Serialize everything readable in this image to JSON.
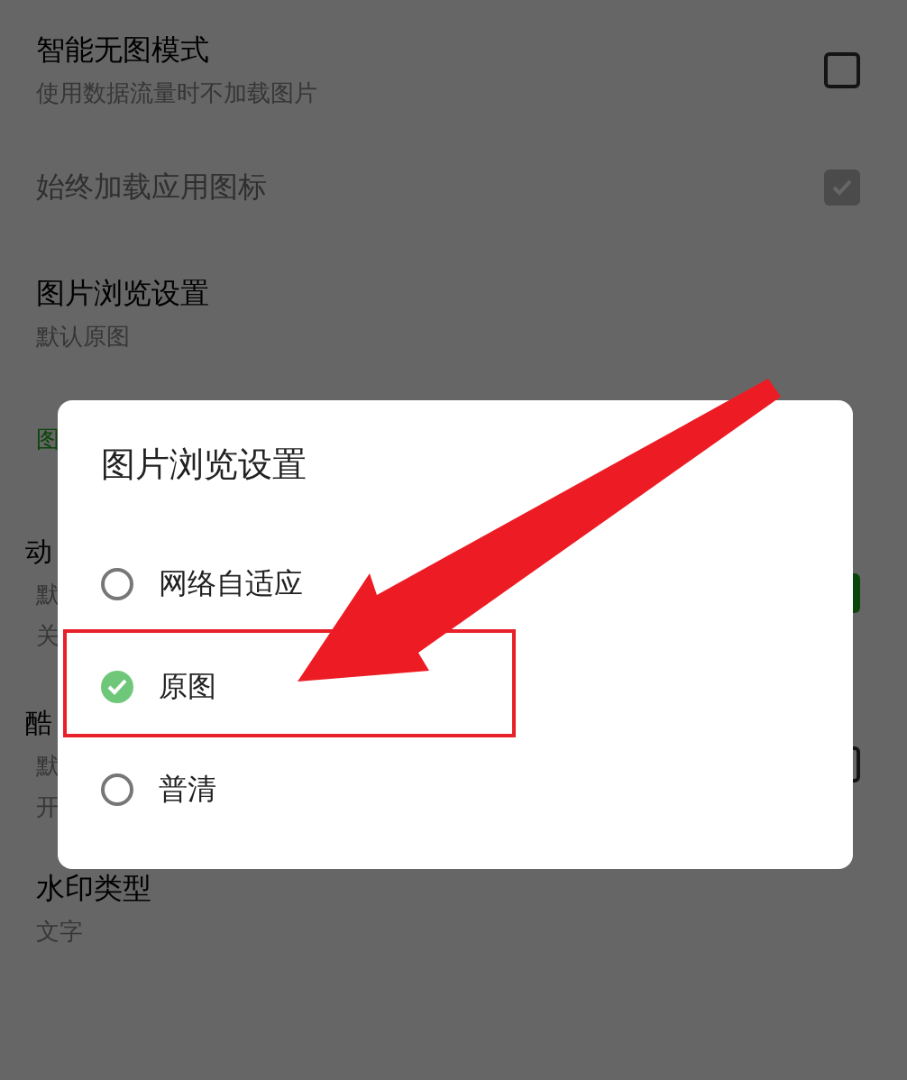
{
  "settings": [
    {
      "kind": "checkbox",
      "title": "智能无图模式",
      "lines": [
        "使用数据流量时不加载图片"
      ],
      "checked": false,
      "disabled": false
    },
    {
      "kind": "checkbox",
      "title": "始终加载应用图标",
      "checked": true,
      "disabled": true
    },
    {
      "kind": "text",
      "title": "图片浏览设置",
      "lines": [
        "默认原图"
      ]
    },
    {
      "kind": "header",
      "title": "图"
    },
    {
      "kind": "switch",
      "title": "动",
      "lines": [
        "默",
        "关"
      ],
      "on": true
    },
    {
      "kind": "checkbox",
      "title": "酷",
      "lines": [
        "默",
        "开"
      ],
      "checked": false,
      "disabled": false
    },
    {
      "kind": "text",
      "title": "水印类型",
      "lines": [
        "文字"
      ]
    }
  ],
  "dialog": {
    "title": "图片浏览设置",
    "options": [
      {
        "label": "网络自适应",
        "selected": false
      },
      {
        "label": "原图",
        "selected": true
      },
      {
        "label": "普清",
        "selected": false
      }
    ]
  }
}
